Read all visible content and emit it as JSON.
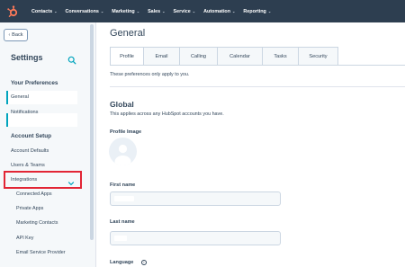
{
  "topnav": {
    "logo": "hubspot-sprocket-icon",
    "items": [
      {
        "label": "Contacts"
      },
      {
        "label": "Conversations"
      },
      {
        "label": "Marketing"
      },
      {
        "label": "Sales"
      },
      {
        "label": "Service"
      },
      {
        "label": "Automation"
      },
      {
        "label": "Reporting"
      }
    ],
    "chevron": "⌄"
  },
  "sidebar": {
    "back_label": "Back",
    "title": "Settings",
    "sections": [
      {
        "heading": "Your Preferences",
        "items": [
          {
            "label": "General",
            "active": true
          },
          {
            "label": "Notifications"
          }
        ]
      },
      {
        "heading": "Account Setup",
        "items": [
          {
            "label": "Account Defaults"
          },
          {
            "label": "Users & Teams"
          },
          {
            "label": "Integrations",
            "expanded": true,
            "highlighted": true
          },
          {
            "label": "Connected Apps",
            "sub": true
          },
          {
            "label": "Private Apps",
            "sub": true
          },
          {
            "label": "Marketing Contacts",
            "sub": true
          },
          {
            "label": "API Key",
            "sub": true
          },
          {
            "label": "Email Service Provider",
            "sub": true
          }
        ]
      }
    ],
    "accent_color": "#00a4bd",
    "highlight_color": "#e22535"
  },
  "main": {
    "title": "General",
    "tabs": [
      {
        "label": "Profile",
        "active": true
      },
      {
        "label": "Email"
      },
      {
        "label": "Calling"
      },
      {
        "label": "Calendar"
      },
      {
        "label": "Tasks"
      },
      {
        "label": "Security"
      }
    ],
    "note": "These preferences only apply to you.",
    "global_title": "Global",
    "global_sub": "This applies across any HubSpot accounts you have.",
    "profile_image_label": "Profile Image",
    "first_name_label": "First name",
    "last_name_label": "Last name",
    "language_label": "Language"
  }
}
